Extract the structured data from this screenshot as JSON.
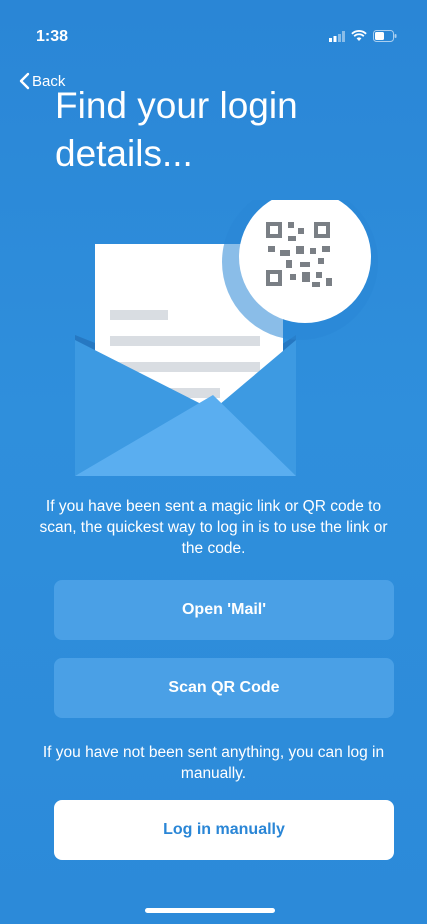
{
  "status_bar": {
    "time": "1:38",
    "icons": [
      "signal-icon",
      "wifi-icon",
      "battery-icon"
    ]
  },
  "nav": {
    "back_label": "Back",
    "back_icon": "chevron-left-icon"
  },
  "title": "Find your login details...",
  "illustration": {
    "icons": [
      "envelope-icon",
      "qr-code-icon"
    ]
  },
  "intro_text": "If you have been sent a magic link or QR code to scan, the quickest way to log in is to use the link or the code.",
  "buttons": {
    "open_mail": "Open 'Mail'",
    "scan_qr": "Scan QR Code",
    "log_in_manually": "Log in manually"
  },
  "manual_text": "If you have not been sent anything, you can log in manually.",
  "colors": {
    "background": "#2a86d6",
    "secondary_button": "#4aa0e6",
    "primary_button": "#ffffff",
    "primary_button_text": "#2a86d6"
  }
}
